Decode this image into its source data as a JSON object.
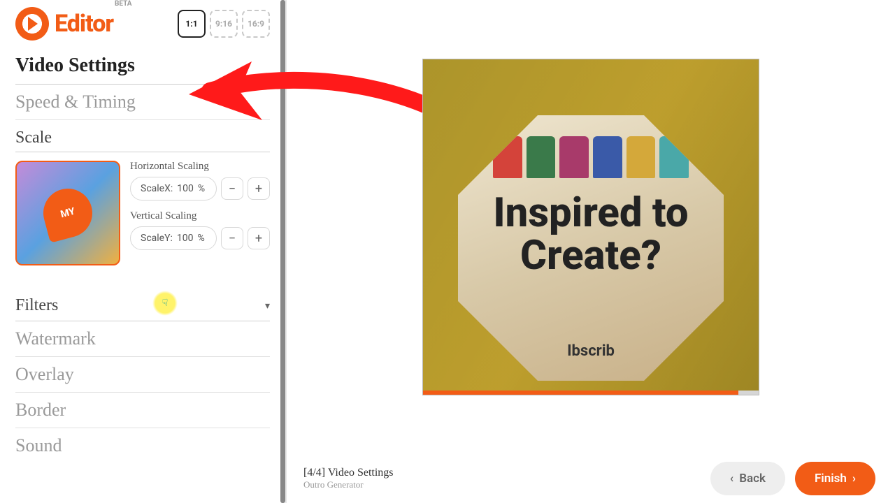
{
  "logo": {
    "text": "Editor",
    "badge": "BETA"
  },
  "ratios": [
    {
      "label": "1:1",
      "active": true
    },
    {
      "label": "9:16",
      "active": false
    },
    {
      "label": "16:9",
      "active": false
    }
  ],
  "sections": {
    "title": "Video Settings",
    "speed": "Speed & Timing",
    "scale": "Scale",
    "filters": "Filters",
    "watermark": "Watermark",
    "overlay": "Overlay",
    "border": "Border",
    "sound": "Sound"
  },
  "scale": {
    "h_label": "Horizontal Scaling",
    "v_label": "Vertical Scaling",
    "x_label": "ScaleX:",
    "y_label": "ScaleY:",
    "x_val": "100",
    "y_val": "100",
    "unit": "%"
  },
  "preview": {
    "headline_l1": "Inspired to",
    "headline_l2": "Create?",
    "caption": "Ibscrib"
  },
  "footer": {
    "step": "[4/4] Video Settings",
    "crumb": "Outro Generator",
    "back": "Back",
    "finish": "Finish"
  },
  "icons": {
    "minus": "−",
    "plus": "+",
    "chev_down": "▾",
    "chev_left": "‹",
    "chev_right": "›"
  }
}
